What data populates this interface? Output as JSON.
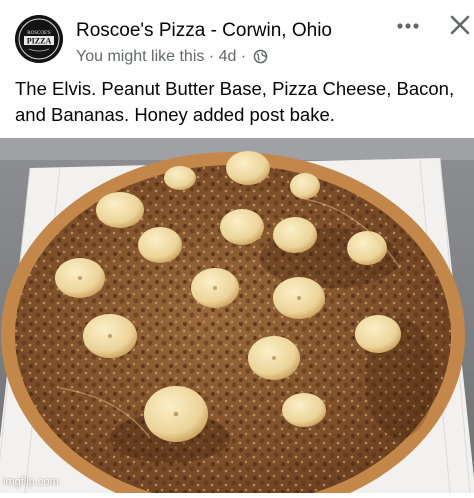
{
  "post": {
    "page_name": "Roscoe's Pizza - Corwin, Ohio",
    "subtitle": "You might like this",
    "time": "4d",
    "separator": "·",
    "text": "The Elvis. Peanut Butter Base, Pizza Cheese, Bacon, and Bananas. Honey added post bake."
  },
  "avatar": {
    "logo_top": "ROSCOE'S",
    "logo_main": "PIZZA"
  },
  "icons": {
    "more": "more-horizontal-icon",
    "close": "close-icon",
    "audience": "globe-icon"
  },
  "watermark": "imgflip.com",
  "colors": {
    "text_primary": "#050505",
    "text_secondary": "#65676b",
    "crust": "#c98a4b",
    "banana": "#f0d9a0"
  }
}
